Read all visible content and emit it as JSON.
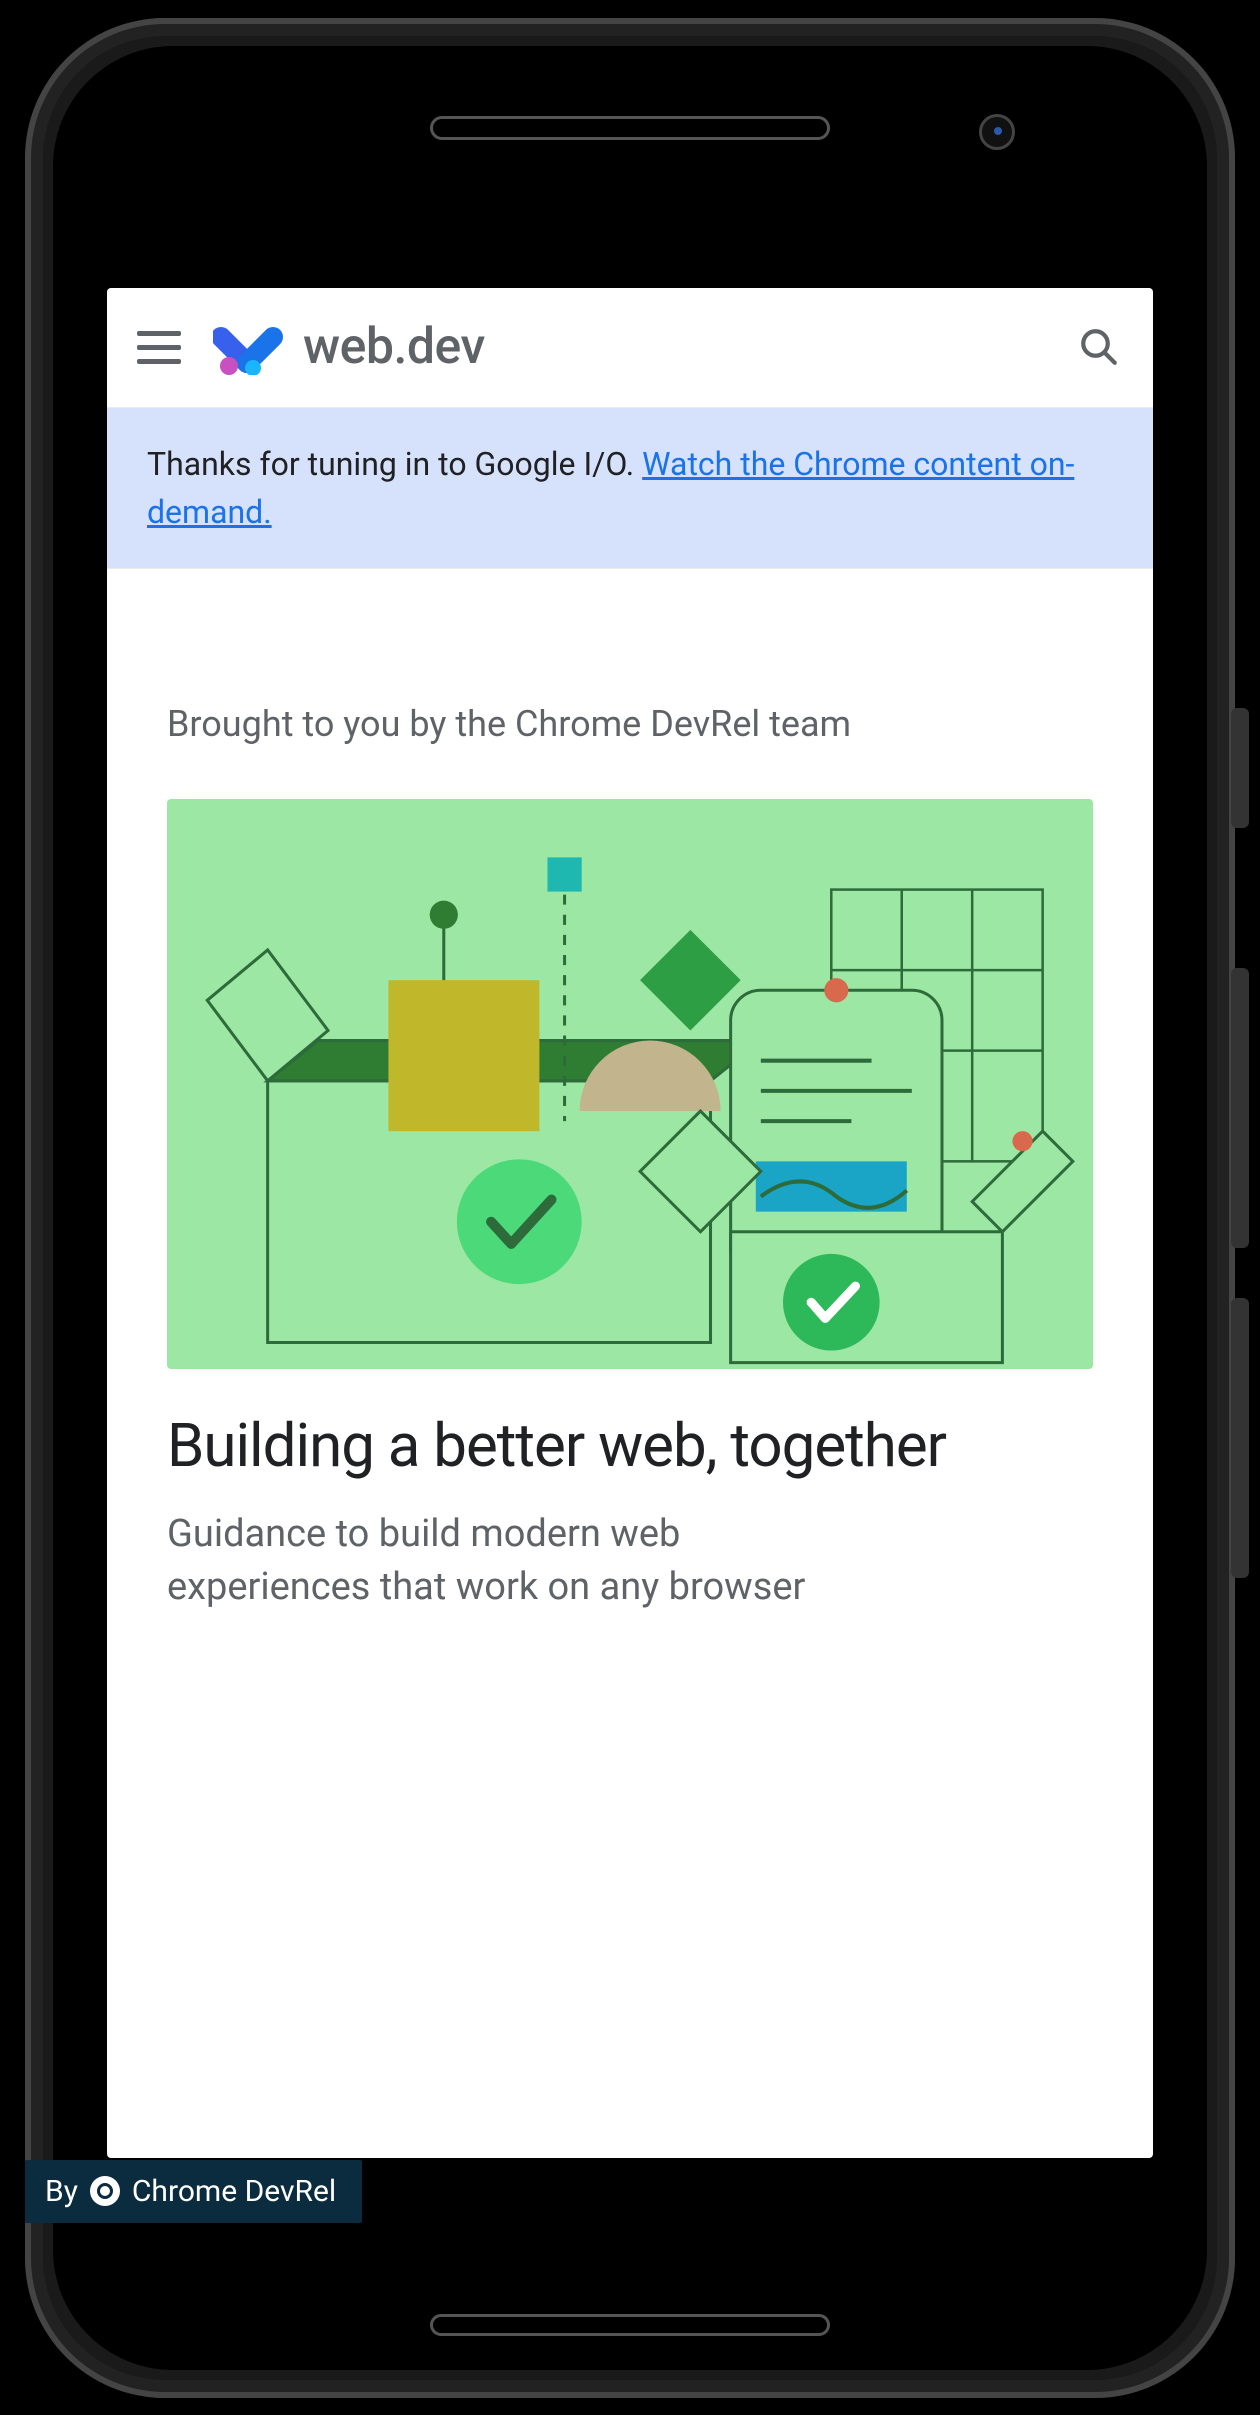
{
  "header": {
    "site_name": "web.dev"
  },
  "banner": {
    "text_before_link": "Thanks for tuning in to Google I/O. ",
    "link_text": "Watch the Chrome content on-demand."
  },
  "hero": {
    "eyebrow": "Brought to you by the Chrome DevRel team",
    "title": "Building a better web, together",
    "description_line1": "Guidance to build modern web",
    "description_line2": "experiences that work on any browser"
  },
  "badge": {
    "prefix": "By",
    "name": "Chrome DevRel"
  }
}
